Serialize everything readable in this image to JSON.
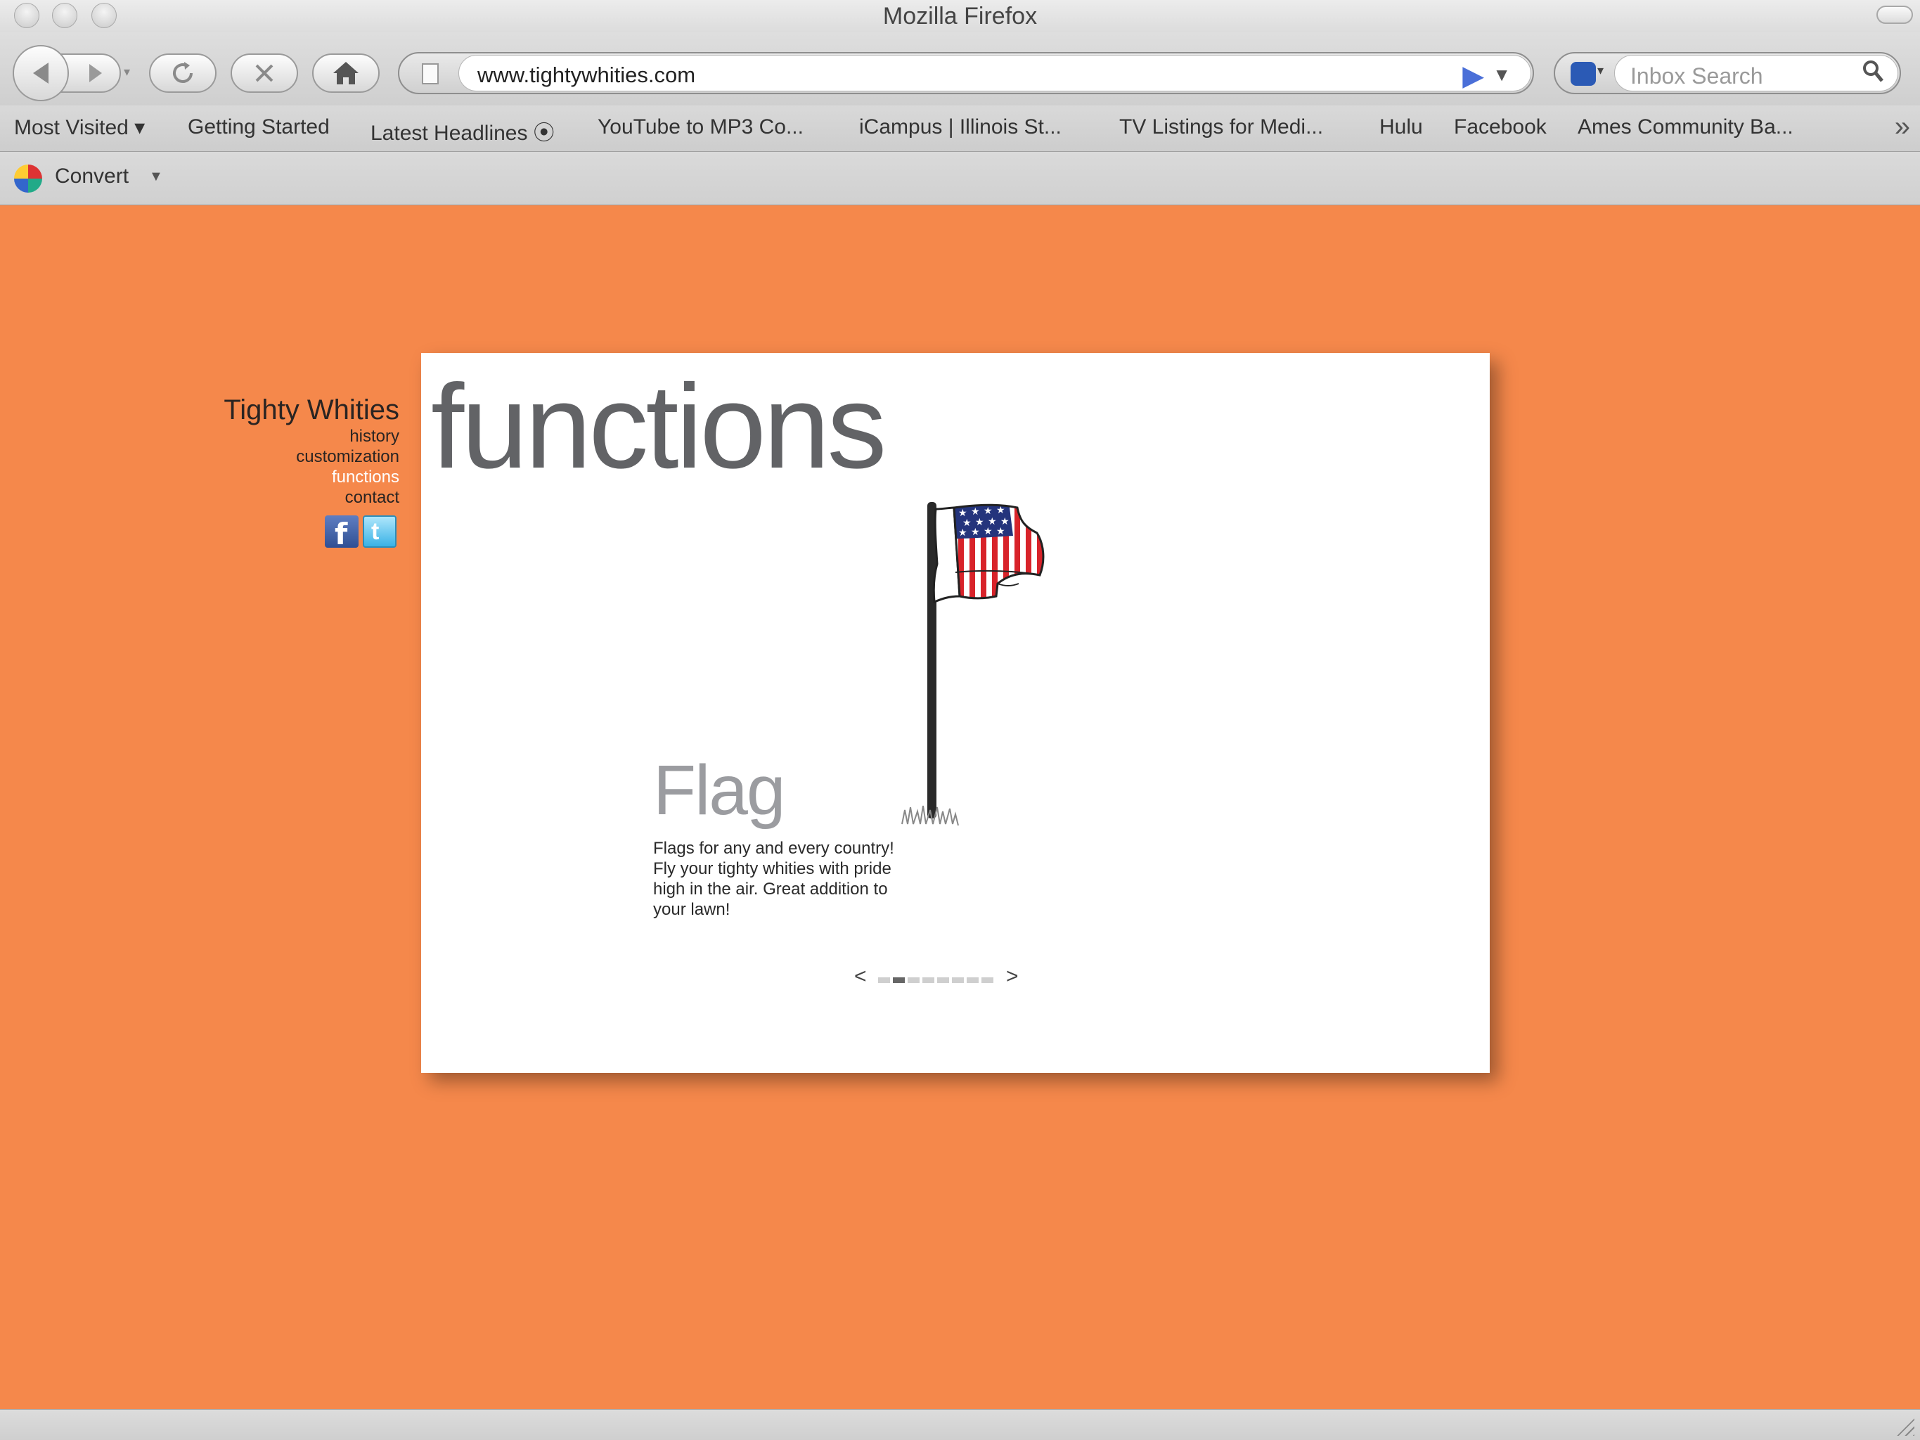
{
  "window": {
    "title": "Mozilla Firefox"
  },
  "toolbar": {
    "url": "www.tightywhities.com",
    "search_placeholder": "Inbox Search"
  },
  "bookmarks": [
    {
      "label": "Most Visited ▾"
    },
    {
      "label": "Getting Started"
    },
    {
      "label": "Latest Headlines ⦿"
    },
    {
      "label": "YouTube to MP3 Co..."
    },
    {
      "label": "iCampus | Illinois St..."
    },
    {
      "label": "TV Listings for Medi..."
    },
    {
      "label": "Hulu"
    },
    {
      "label": "Facebook"
    },
    {
      "label": "Ames Community Ba..."
    }
  ],
  "addon": {
    "label": "Convert"
  },
  "site": {
    "title": "Tighty Whities",
    "nav": [
      {
        "label": "history"
      },
      {
        "label": "customization"
      },
      {
        "label": "functions",
        "active": true
      },
      {
        "label": "contact"
      }
    ],
    "social": [
      {
        "name": "facebook-icon",
        "glyph": "f"
      },
      {
        "name": "twitter-icon",
        "glyph": "t"
      }
    ]
  },
  "page": {
    "heading": "functions",
    "feature": {
      "title": "Flag",
      "description": "Flags for any and every country! Fly your tighty whities with pride high in the air. Great addition to your lawn!"
    },
    "pager": {
      "prev": "<",
      "next": ">",
      "total": 8,
      "current": 2
    }
  },
  "colors": {
    "page_background": "#f5884b",
    "panel_background": "#ffffff",
    "heading_text": "#626366",
    "active_nav": "#ffffff"
  }
}
